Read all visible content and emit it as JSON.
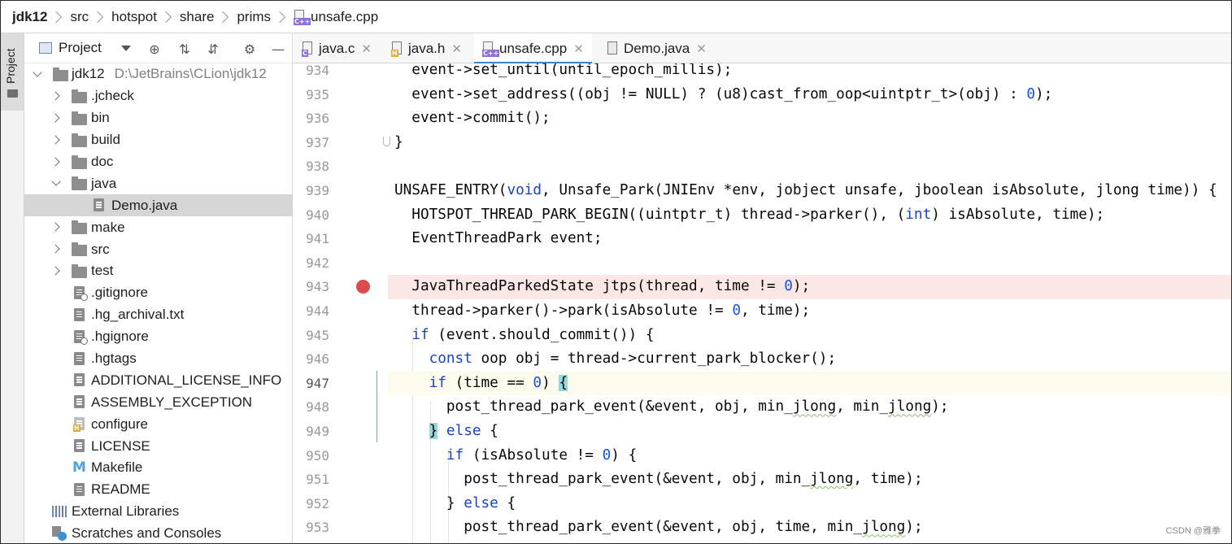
{
  "breadcrumb": [
    "jdk12",
    "src",
    "hotspot",
    "share",
    "prims",
    "unsafe.cpp"
  ],
  "breadcrumb_file_tag": "C++",
  "side_stripe": {
    "label": "Project"
  },
  "project_panel": {
    "title": "Project",
    "tools": [
      "target-icon",
      "expand-all-icon",
      "collapse-all-icon",
      "gear-icon",
      "minimize-icon"
    ],
    "root": {
      "name": "jdk12",
      "path": "D:\\JetBrains\\CLion\\jdk12"
    },
    "items": [
      {
        "label": ".jcheck",
        "kind": "folder",
        "state": "collapsed"
      },
      {
        "label": "bin",
        "kind": "folder",
        "state": "collapsed"
      },
      {
        "label": "build",
        "kind": "folder",
        "state": "collapsed"
      },
      {
        "label": "doc",
        "kind": "folder",
        "state": "collapsed"
      },
      {
        "label": "java",
        "kind": "folder",
        "state": "expanded"
      },
      {
        "label": "Demo.java",
        "kind": "file",
        "selected": true
      },
      {
        "label": "make",
        "kind": "folder",
        "state": "collapsed"
      },
      {
        "label": "src",
        "kind": "folder",
        "state": "collapsed"
      },
      {
        "label": "test",
        "kind": "folder",
        "state": "collapsed"
      },
      {
        "label": ".gitignore",
        "kind": "ignore-file"
      },
      {
        "label": ".hg_archival.txt",
        "kind": "file"
      },
      {
        "label": ".hgignore",
        "kind": "ignore-file"
      },
      {
        "label": ".hgtags",
        "kind": "file"
      },
      {
        "label": "ADDITIONAL_LICENSE_INFO",
        "kind": "file"
      },
      {
        "label": "ASSEMBLY_EXCEPTION",
        "kind": "file"
      },
      {
        "label": "configure",
        "kind": "header-file"
      },
      {
        "label": "LICENSE",
        "kind": "file"
      },
      {
        "label": "Makefile",
        "kind": "makefile"
      },
      {
        "label": "README",
        "kind": "file"
      }
    ],
    "external_libraries": "External Libraries",
    "scratches": "Scratches and Consoles"
  },
  "tabs": [
    {
      "label": "java.c",
      "tag": "C",
      "active": false
    },
    {
      "label": "java.h",
      "tag": "H",
      "active": false
    },
    {
      "label": "unsafe.cpp",
      "tag": "C++",
      "active": true
    },
    {
      "label": "Demo.java",
      "tag": "",
      "active": false
    }
  ],
  "tab_close": "✕",
  "editor": {
    "lines": [
      {
        "n": "934",
        "text": "  event->set_until(until_epoch_millis);"
      },
      {
        "n": "935",
        "text": "  event->set_address((obj != NULL) ? (u8)cast_from_oop<uintptr_t>(obj) : 0);"
      },
      {
        "n": "936",
        "text": "  event->commit();"
      },
      {
        "n": "937",
        "text": "}"
      },
      {
        "n": "938",
        "text": ""
      },
      {
        "n": "939",
        "text": "UNSAFE_ENTRY(void, Unsafe_Park(JNIEnv *env, jobject unsafe, jboolean isAbsolute, jlong time)) {"
      },
      {
        "n": "940",
        "text": "  HOTSPOT_THREAD_PARK_BEGIN((uintptr_t) thread->parker(), (int) isAbsolute, time);"
      },
      {
        "n": "941",
        "text": "  EventThreadPark event;"
      },
      {
        "n": "942",
        "text": ""
      },
      {
        "n": "943",
        "text": "  JavaThreadParkedState jtps(thread, time != 0);",
        "breakpoint": true
      },
      {
        "n": "944",
        "text": "  thread->parker()->park(isAbsolute != 0, time);"
      },
      {
        "n": "945",
        "text": "  if (event.should_commit()) {"
      },
      {
        "n": "946",
        "text": "    const oop obj = thread->current_park_blocker();"
      },
      {
        "n": "947",
        "text": "    if (time == 0) {",
        "current": true
      },
      {
        "n": "948",
        "text": "      post_thread_park_event(&event, obj, min_jlong, min_jlong);"
      },
      {
        "n": "949",
        "text": "    } else {"
      },
      {
        "n": "950",
        "text": "      if (isAbsolute != 0) {"
      },
      {
        "n": "951",
        "text": "        post_thread_park_event(&event, obj, min_jlong, time);"
      },
      {
        "n": "952",
        "text": "      } else {"
      },
      {
        "n": "953",
        "text": "        post_thread_park_event(&event, obj, time, min_jlong);"
      }
    ]
  },
  "watermark": "CSDN @雅拳"
}
